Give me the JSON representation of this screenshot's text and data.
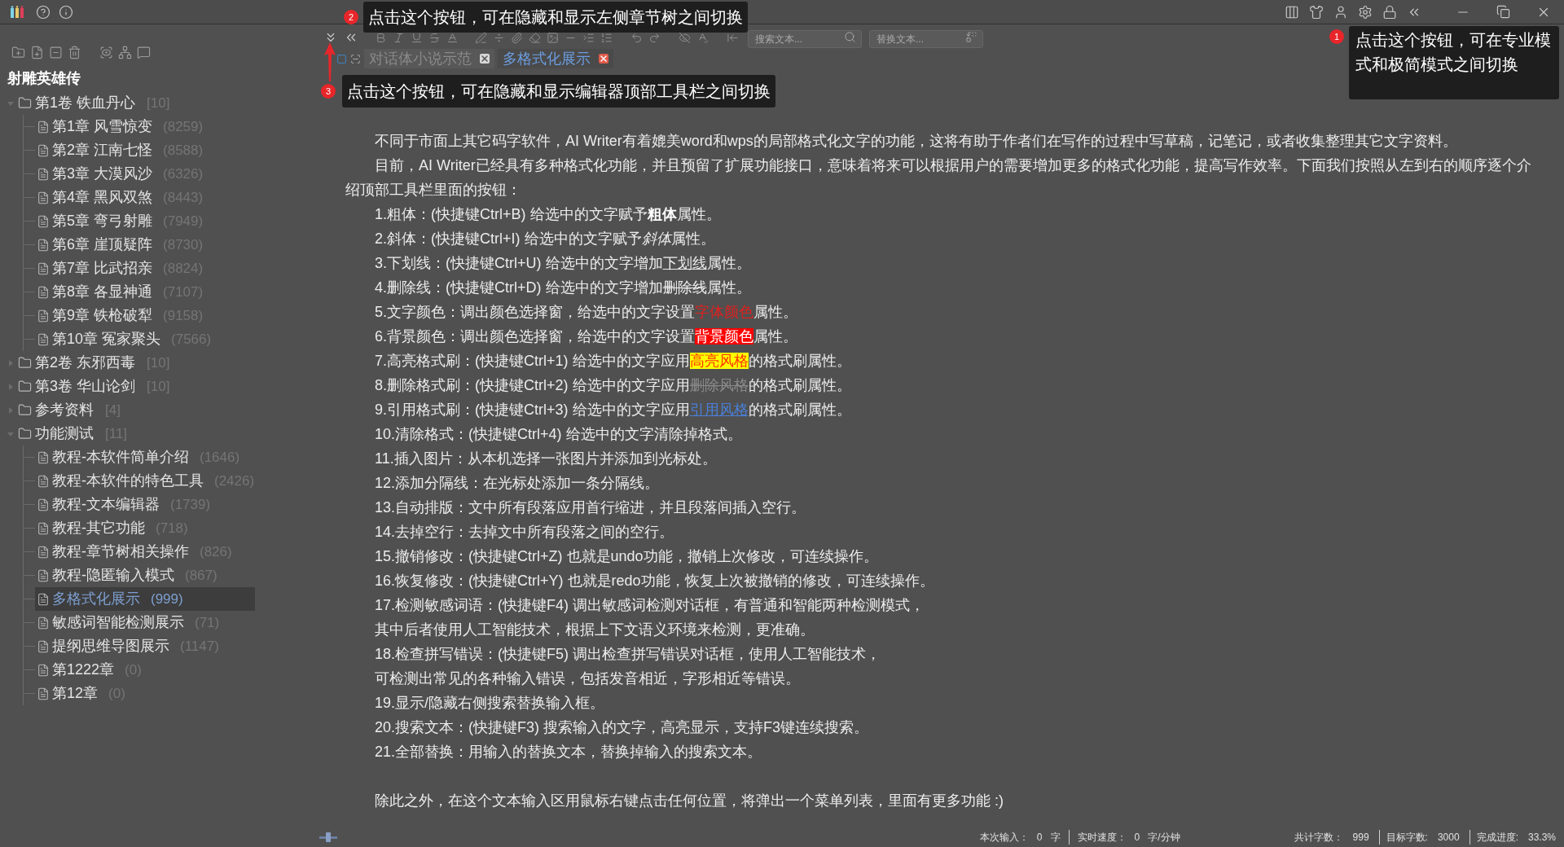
{
  "callouts": [
    {
      "number": "2",
      "text": "点击这个按钮，可在隐藏和显示左侧章节树之间切换"
    },
    {
      "number": "3",
      "text": "点击这个按钮，可在隐藏和显示编辑器顶部工具栏之间切换"
    },
    {
      "number": "1",
      "text": "点击这个按钮，可在专业模式和极简模式之间切换"
    }
  ],
  "sidebar": {
    "book_title": "射雕英雄传",
    "tree": [
      {
        "kind": "folder",
        "label": "第1卷 铁血丹心",
        "count": "[10]",
        "expanded": true,
        "selected": false,
        "children": [
          {
            "kind": "chapter",
            "label": "第1章 风雪惊变",
            "count": "(8259)",
            "selected": false
          },
          {
            "kind": "chapter",
            "label": "第2章 江南七怪",
            "count": "(8588)",
            "selected": false
          },
          {
            "kind": "chapter",
            "label": "第3章 大漠风沙",
            "count": "(6326)",
            "selected": false
          },
          {
            "kind": "chapter",
            "label": "第4章 黑风双煞",
            "count": "(8443)",
            "selected": false
          },
          {
            "kind": "chapter",
            "label": "第5章 弯弓射雕",
            "count": "(7949)",
            "selected": false
          },
          {
            "kind": "chapter",
            "label": "第6章 崖顶疑阵",
            "count": "(8730)",
            "selected": false
          },
          {
            "kind": "chapter",
            "label": "第7章 比武招亲",
            "count": "(8824)",
            "selected": false
          },
          {
            "kind": "chapter",
            "label": "第8章 各显神通",
            "count": "(7107)",
            "selected": false
          },
          {
            "kind": "chapter",
            "label": "第9章 铁枪破犁",
            "count": "(9158)",
            "selected": false
          },
          {
            "kind": "chapter",
            "label": "第10章 冤家聚头",
            "count": "(7566)",
            "selected": false
          }
        ]
      },
      {
        "kind": "folder",
        "label": "第2卷 东邪西毒",
        "count": "[10]",
        "expanded": false,
        "selected": false
      },
      {
        "kind": "folder",
        "label": "第3卷 华山论剑",
        "count": "[10]",
        "expanded": false,
        "selected": false
      },
      {
        "kind": "folder",
        "label": "参考资料",
        "count": "[4]",
        "expanded": false,
        "selected": false
      },
      {
        "kind": "folder",
        "label": "功能测试",
        "count": "[11]",
        "expanded": true,
        "selected": false,
        "children": [
          {
            "kind": "chapter",
            "label": "教程-本软件简单介绍",
            "count": "(1646)",
            "selected": false
          },
          {
            "kind": "chapter",
            "label": "教程-本软件的特色工具",
            "count": "(2426)",
            "selected": false
          },
          {
            "kind": "chapter",
            "label": "教程-文本编辑器",
            "count": "(1739)",
            "selected": false
          },
          {
            "kind": "chapter",
            "label": "教程-其它功能",
            "count": "(718)",
            "selected": false
          },
          {
            "kind": "chapter",
            "label": "教程-章节树相关操作",
            "count": "(826)",
            "selected": false
          },
          {
            "kind": "chapter",
            "label": "教程-隐匿输入模式",
            "count": "(867)",
            "selected": false
          },
          {
            "kind": "chapter",
            "label": "多格式化展示",
            "count": "(999)",
            "selected": true
          },
          {
            "kind": "chapter",
            "label": "敏感词智能检测展示",
            "count": "(71)",
            "selected": false
          },
          {
            "kind": "chapter",
            "label": "提纲思维导图展示",
            "count": "(1147)",
            "selected": false
          },
          {
            "kind": "chapter",
            "label": "第1222章",
            "count": "(0)",
            "selected": false
          },
          {
            "kind": "chapter",
            "label": "第12章",
            "count": "(0)",
            "selected": false
          }
        ]
      }
    ]
  },
  "search_field": {
    "placeholder": "搜索文本..."
  },
  "replace_field": {
    "placeholder": "替换文本..."
  },
  "tabs": [
    {
      "label": "对话体小说示范",
      "selected": false
    },
    {
      "label": "多格式化展示",
      "selected": true
    }
  ],
  "editor": {
    "paragraphs": [
      {
        "kind": "text",
        "segments": [
          {
            "kind": "plain",
            "text": "不同于市面上其它码字软件，AI Writer有着媲美word和wps的局部格式化文字的功能，这将有助于作者们在写作的过程中写草稿，记笔记，或者收集整理其它文字资料。"
          }
        ]
      },
      {
        "kind": "text",
        "segments": [
          {
            "kind": "plain",
            "text": "目前，AI Writer已经具有多种格式化功能，并且预留了扩展功能接口，意味着将来可以根据用户的需要增加更多的格式化功能，提高写作效率。下面我们按照从左到右的顺序逐个介绍顶部工具栏里面的按钮："
          }
        ]
      },
      {
        "kind": "text",
        "segments": [
          {
            "kind": "plain",
            "text": "1.粗体：(快捷键Ctrl+B) 给选中的文字赋予"
          },
          {
            "kind": "bold",
            "text": "粗体"
          },
          {
            "kind": "plain",
            "text": "属性。"
          }
        ]
      },
      {
        "kind": "text",
        "segments": [
          {
            "kind": "plain",
            "text": "2.斜体：(快捷键Ctrl+I) 给选中的文字赋予"
          },
          {
            "kind": "italic",
            "text": "斜体"
          },
          {
            "kind": "plain",
            "text": "属性。"
          }
        ]
      },
      {
        "kind": "text",
        "segments": [
          {
            "kind": "plain",
            "text": "3.下划线：(快捷键Ctrl+U) 给选中的文字增加"
          },
          {
            "kind": "underline",
            "text": "下划线"
          },
          {
            "kind": "plain",
            "text": "属性。"
          }
        ]
      },
      {
        "kind": "text",
        "segments": [
          {
            "kind": "plain",
            "text": "4.删除线：(快捷键Ctrl+D) 给选中的文字增加"
          },
          {
            "kind": "strike",
            "text": "删除线"
          },
          {
            "kind": "plain",
            "text": "属性。"
          }
        ]
      },
      {
        "kind": "text",
        "segments": [
          {
            "kind": "plain",
            "text": "5.文字颜色：调出颜色选择窗，给选中的文字设置"
          },
          {
            "kind": "font_color",
            "text": "字体颜色"
          },
          {
            "kind": "plain",
            "text": "属性。"
          }
        ]
      },
      {
        "kind": "text",
        "segments": [
          {
            "kind": "plain",
            "text": "6.背景颜色：调出颜色选择窗，给选中的文字设置"
          },
          {
            "kind": "background",
            "text": "背景颜色"
          },
          {
            "kind": "plain",
            "text": "属性。"
          }
        ]
      },
      {
        "kind": "text",
        "segments": [
          {
            "kind": "plain",
            "text": "7.高亮格式刷：(快捷键Ctrl+1) 给选中的文字应用"
          },
          {
            "kind": "highlight",
            "text": "高亮风格"
          },
          {
            "kind": "plain",
            "text": "的格式刷属性。"
          }
        ]
      },
      {
        "kind": "text",
        "segments": [
          {
            "kind": "plain",
            "text": "8.删除格式刷：(快捷键Ctrl+2) 给选中的文字应用"
          },
          {
            "kind": "deleted",
            "text": "删除风格"
          },
          {
            "kind": "plain",
            "text": "的格式刷属性。"
          }
        ]
      },
      {
        "kind": "text",
        "segments": [
          {
            "kind": "plain",
            "text": "9.引用格式刷：(快捷键Ctrl+3) 给选中的文字应用"
          },
          {
            "kind": "quote",
            "text": "引用风格"
          },
          {
            "kind": "plain",
            "text": "的格式刷属性。"
          }
        ]
      },
      {
        "kind": "text",
        "segments": [
          {
            "kind": "plain",
            "text": "10.清除格式：(快捷键Ctrl+4) 给选中的文字清除掉格式。"
          }
        ]
      },
      {
        "kind": "text",
        "segments": [
          {
            "kind": "plain",
            "text": "11.插入图片：从本机选择一张图片并添加到光标处。"
          }
        ]
      },
      {
        "kind": "text",
        "segments": [
          {
            "kind": "plain",
            "text": "12.添加分隔线：在光标处添加一条分隔线。"
          }
        ]
      },
      {
        "kind": "text",
        "segments": [
          {
            "kind": "plain",
            "text": "13.自动排版：文中所有段落应用首行缩进，并且段落间插入空行。"
          }
        ]
      },
      {
        "kind": "text",
        "segments": [
          {
            "kind": "plain",
            "text": "14.去掉空行：去掉文中所有段落之间的空行。"
          }
        ]
      },
      {
        "kind": "text",
        "segments": [
          {
            "kind": "plain",
            "text": "15.撤销修改：(快捷键Ctrl+Z) 也就是undo功能，撤销上次修改，可连续操作。"
          }
        ]
      },
      {
        "kind": "text",
        "segments": [
          {
            "kind": "plain",
            "text": "16.恢复修改：(快捷键Ctrl+Y) 也就是redo功能，恢复上次被撤销的修改，可连续操作。"
          }
        ]
      },
      {
        "kind": "text",
        "segments": [
          {
            "kind": "plain",
            "text": "17.检测敏感词语：(快捷键F4) 调出敏感词检测对话框，有普通和智能两种检测模式，"
          }
        ]
      },
      {
        "kind": "text",
        "segments": [
          {
            "kind": "plain",
            "text": "其中后者使用人工智能技术，根据上下文语义环境来检测，更准确。"
          }
        ]
      },
      {
        "kind": "text",
        "segments": [
          {
            "kind": "plain",
            "text": "18.检查拼写错误：(快捷键F5) 调出检查拼写错误对话框，使用人工智能技术，"
          }
        ]
      },
      {
        "kind": "text",
        "segments": [
          {
            "kind": "plain",
            "text": "可检测出常见的各种输入错误，包括发音相近，字形相近等错误。"
          }
        ]
      },
      {
        "kind": "text",
        "segments": [
          {
            "kind": "plain",
            "text": "19.显示/隐藏右侧搜索替换输入框。"
          }
        ]
      },
      {
        "kind": "text",
        "segments": [
          {
            "kind": "plain",
            "text": "20.搜索文本：(快捷键F3) 搜索输入的文字，高亮显示，支持F3键连续搜索。"
          }
        ]
      },
      {
        "kind": "text",
        "segments": [
          {
            "kind": "plain",
            "text": "21.全部替换：用输入的替换文本，替换掉输入的搜索文本。"
          }
        ]
      },
      {
        "kind": "blank"
      },
      {
        "kind": "text",
        "segments": [
          {
            "kind": "plain",
            "text": "除此之外，在这个文本输入区用鼠标右键点击任何位置，将弹出一个菜单列表，里面有更多功能 :)"
          }
        ]
      }
    ]
  },
  "status_bar": {
    "left": [
      {
        "label": "本次输入：",
        "value": "0",
        "unit": "字"
      },
      {
        "label": "实时速度：",
        "value": "0",
        "unit": "字/分钟"
      }
    ],
    "right": [
      {
        "label": "共计字数：",
        "value": "999"
      },
      {
        "label": "目标字数:",
        "value": "3000"
      },
      {
        "label": "完成进度:",
        "value": "33.3%"
      }
    ]
  }
}
